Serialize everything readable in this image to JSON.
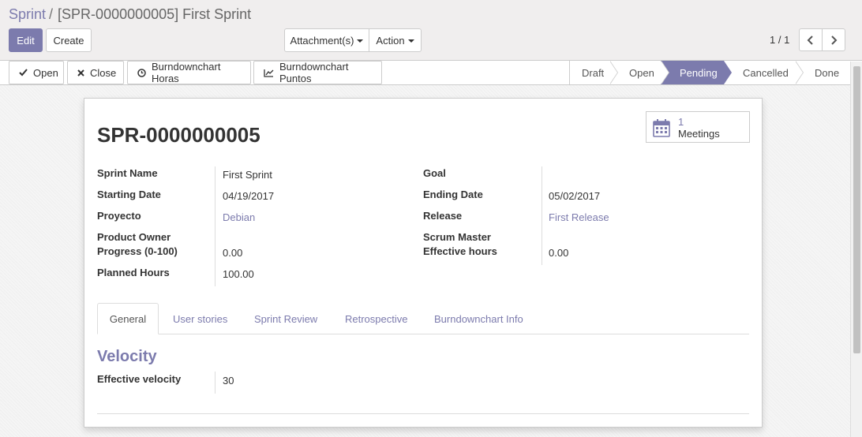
{
  "breadcrumb": {
    "parent": "Sprint",
    "separator": "/",
    "current": "[SPR-0000000005] First Sprint"
  },
  "buttons": {
    "edit": "Edit",
    "create": "Create",
    "attachments": "Attachment(s)",
    "action": "Action"
  },
  "pager": {
    "value": "1 / 1"
  },
  "statusbar": {
    "buttons": {
      "open": "Open",
      "close": "Close",
      "burndown_hours": "Burndownchart Horas",
      "burndown_points": "Burndownchart Puntos"
    },
    "stages": [
      "Draft",
      "Open",
      "Pending",
      "Cancelled",
      "Done"
    ],
    "active_stage": "Pending"
  },
  "smart_button": {
    "count": "1",
    "label": "Meetings"
  },
  "record": {
    "title": "SPR-0000000005"
  },
  "fields_left": {
    "sprint_name": {
      "label": "Sprint Name",
      "value": "First Sprint"
    },
    "starting_date": {
      "label": "Starting Date",
      "value": "04/19/2017"
    },
    "proyecto": {
      "label": "Proyecto",
      "value": "Debian"
    },
    "product_owner": {
      "label": "Product Owner",
      "value": ""
    },
    "progress": {
      "label": "Progress (0-100)",
      "value": "0.00"
    },
    "planned_hours": {
      "label": "Planned Hours",
      "value": "100.00"
    }
  },
  "fields_right": {
    "goal": {
      "label": "Goal",
      "value": ""
    },
    "ending_date": {
      "label": "Ending Date",
      "value": "05/02/2017"
    },
    "release": {
      "label": "Release",
      "value": "First Release"
    },
    "scrum_master": {
      "label": "Scrum Master",
      "value": ""
    },
    "effective_hours": {
      "label": "Effective hours",
      "value": "0.00"
    }
  },
  "tabs": [
    "General",
    "User stories",
    "Sprint Review",
    "Retrospective",
    "Burndownchart Info"
  ],
  "active_tab": "General",
  "velocity": {
    "title": "Velocity",
    "effective_velocity": {
      "label": "Effective velocity",
      "value": "30"
    }
  },
  "colors": {
    "brand": "#7c7bad",
    "control_panel": "#f0eeee"
  }
}
